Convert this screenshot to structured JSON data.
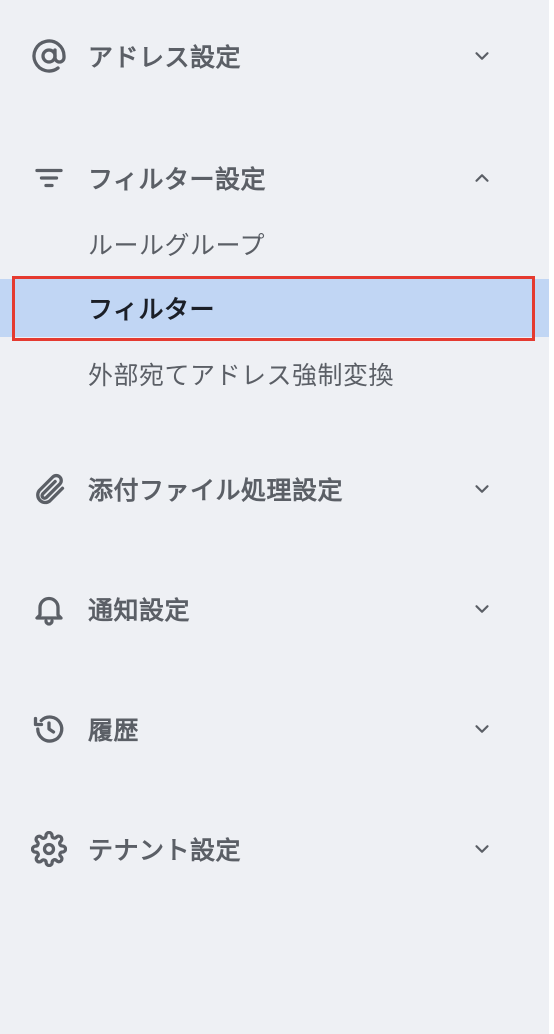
{
  "nav": {
    "address": {
      "label": "アドレス設定",
      "icon": "at-sign-icon",
      "expanded": false
    },
    "filter": {
      "label": "フィルター設定",
      "icon": "filter-lines-icon",
      "expanded": true,
      "items": [
        {
          "label": "ルールグループ",
          "active": false
        },
        {
          "label": "フィルター",
          "active": true
        },
        {
          "label": "外部宛てアドレス強制変換",
          "active": false
        }
      ]
    },
    "attachment": {
      "label": "添付ファイル処理設定",
      "icon": "paperclip-icon",
      "expanded": false
    },
    "notification": {
      "label": "通知設定",
      "icon": "bell-icon",
      "expanded": false
    },
    "history": {
      "label": "履歴",
      "icon": "history-icon",
      "expanded": false
    },
    "tenant": {
      "label": "テナント設定",
      "icon": "gear-icon",
      "expanded": false
    }
  },
  "colors": {
    "background": "#eef0f4",
    "active_background": "#c1d6f4",
    "highlight_border": "#e53a30",
    "text": "#5b5f66",
    "active_text": "#1b1f27"
  }
}
